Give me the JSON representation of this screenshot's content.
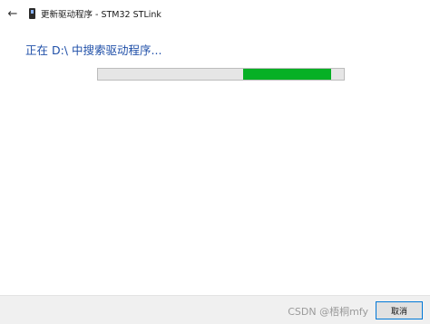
{
  "window": {
    "title": "更新驱动程序 - STM32 STLink",
    "back_icon": "←",
    "device_icon_name": "device-icon"
  },
  "main": {
    "heading": "正在 D:\\ 中搜索驱动程序...",
    "progress_fraction": 0.36,
    "progress_color": "#06b025",
    "heading_color": "#1f4fa8"
  },
  "footer": {
    "watermark": "CSDN @梧桐mfy",
    "cancel_label": "取消"
  }
}
